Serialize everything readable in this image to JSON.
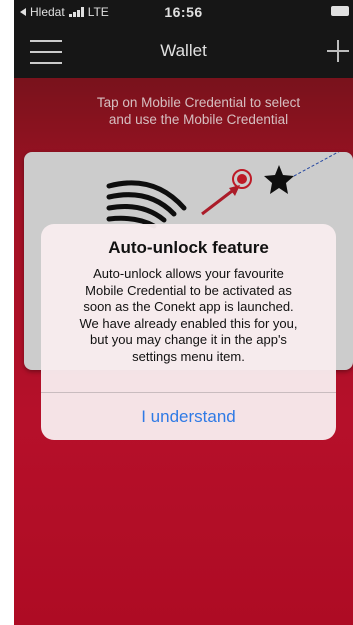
{
  "status_bar": {
    "back_label": "Hledat",
    "network": "LTE",
    "time": "16:56"
  },
  "nav": {
    "title": "Wallet"
  },
  "instruction": {
    "line1": "Tap on Mobile Credential to select",
    "line2": "and use the Mobile Credential"
  },
  "alert": {
    "title": "Auto-unlock feature",
    "message_lines": [
      "Auto-unlock allows your favourite",
      "Mobile Credential to be activated as",
      "soon as the Conekt app is launched.",
      "We have already enabled this for you,",
      "but you may change it in the app's",
      "settings menu item."
    ],
    "button_label": "I understand"
  },
  "icons": {
    "menu": "hamburger-icon",
    "add": "plus-icon",
    "nfc": "contactless-waves-icon",
    "target": "target-icon",
    "favourite": "star-icon"
  },
  "colors": {
    "nav_background": "#1a1a1a",
    "screen_red": "#c70d2a",
    "alert_button": "#2f7ae5"
  }
}
